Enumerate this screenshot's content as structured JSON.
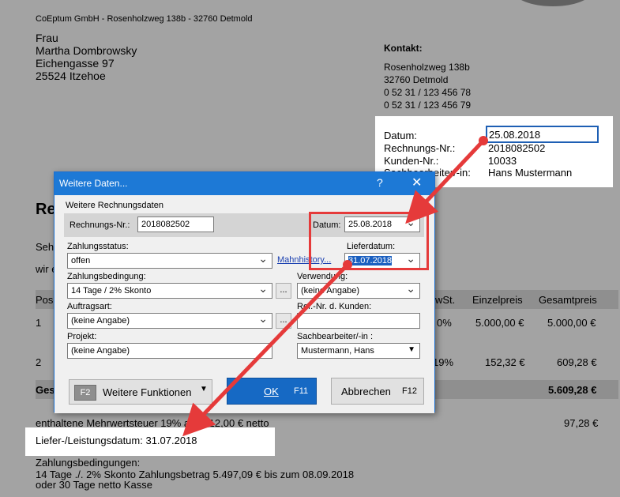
{
  "document": {
    "sender_line": "CoEptum GmbH - Rosenholzweg 138b - 32760 Detmold",
    "recipient": [
      "Frau",
      "Martha Dombrowsky",
      "Eichengasse 97",
      "25524 Itzehoe"
    ],
    "contact_title": "Kontakt:",
    "contact_lines": [
      "Rosenholzweg 138b",
      "32760 Detmold",
      "0 52 31 / 123 456 78",
      "0 52 31 / 123 456 79"
    ],
    "info": {
      "datum_label": "Datum:",
      "datum_value": "25.08.2018",
      "rnr_label": "Rechnungs-Nr.:",
      "rnr_value": "2018082502",
      "knr_label": "Kunden-Nr.:",
      "knr_value": "10033",
      "sb_label": "Sachbearbeiter/-in:",
      "sb_value": "Hans Mustermann"
    },
    "heading_partial": "Re",
    "body_partial_1": "Seh",
    "body_partial_2": "wir e",
    "table_header": {
      "pos": "Pos",
      "mwst": "wSt.",
      "einzelpreis": "Einzelpreis",
      "gesamtpreis": "Gesamtpreis"
    },
    "rows": [
      {
        "pos": "1",
        "mwst": "0%",
        "einzel": "5.000,00 €",
        "gesamt": "5.000,00 €"
      },
      {
        "pos": "2",
        "mwst": "19%",
        "einzel": "152,32 €",
        "gesamt": "609,28 €"
      }
    ],
    "sum_label": "Ges",
    "sum_value": "5.609,28 €",
    "vat_text": "enthaltene Mehrwertsteuer 19% aus 512,00 € netto",
    "vat_value": "97,28 €",
    "lief_text": "Liefer-/Leistungsdatum: 31.07.2018",
    "zahlung_title": "Zahlungsbedingungen:",
    "zahlung_line1": "14 Tage ./. 2% Skonto Zahlungsbetrag 5.497,09 € bis zum 08.09.2018",
    "zahlung_line2": "oder 30 Tage netto Kasse"
  },
  "dialog": {
    "title": "Weitere Daten...",
    "help": "?",
    "close": "✕",
    "group_label": "Weitere Rechnungsdaten",
    "rnr_label": "Rechnungs-Nr.:",
    "rnr_value": "2018082502",
    "datum_label": "Datum:",
    "datum_value": "25.08.2018",
    "zahlungsstatus_label": "Zahlungsstatus:",
    "zahlungsstatus_value": "offen",
    "mahnhistory_link": "Mahnhistory...",
    "lieferdatum_label": "Lieferdatum:",
    "lieferdatum_value": "31.07.2018",
    "zahlungsbedingung_label": "Zahlungsbedingung:",
    "zahlungsbedingung_value": "14 Tage / 2% Skonto",
    "verwendung_label": "Verwendung:",
    "verwendung_value": "(keine Angabe)",
    "auftragsart_label": "Auftragsart:",
    "auftragsart_value": "(keine Angabe)",
    "refnr_label": "Ref.-Nr. d. Kunden:",
    "refnr_value": "",
    "projekt_label": "Projekt:",
    "projekt_value": "(keine Angabe)",
    "sachbearbeiter_label": "Sachbearbeiter/-in :",
    "sachbearbeiter_value": "Mustermann, Hans",
    "dots": "...",
    "btn_weitere_key": "F2",
    "btn_weitere_label": "Weitere Funktionen",
    "btn_ok_label": "OK",
    "btn_ok_key": "F11",
    "btn_abbrechen_label": "Abbrechen",
    "btn_abbrechen_key": "F12"
  },
  "colors": {
    "accent": "#1d79d6",
    "annotation": "#e53a3a",
    "background": "#a3a3a3"
  }
}
